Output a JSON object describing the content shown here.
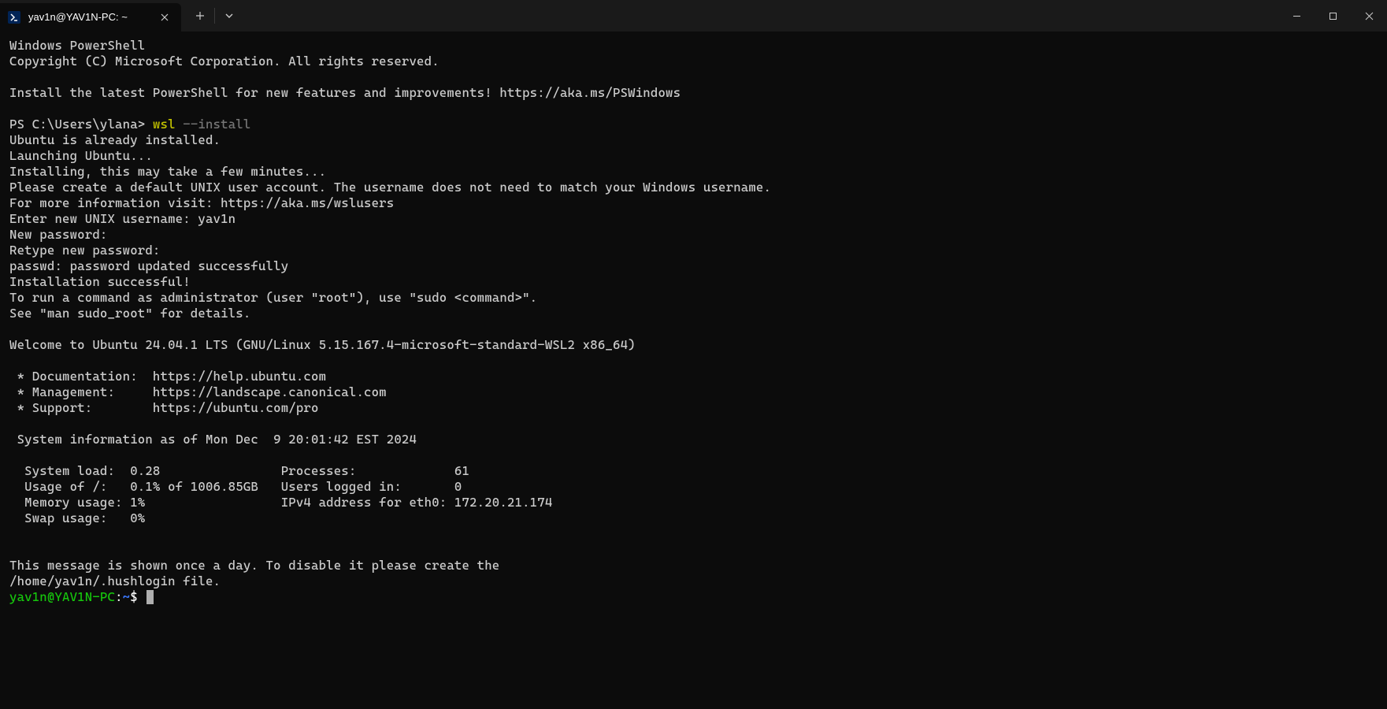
{
  "titlebar": {
    "tab_title": "yav1n@YAV1N-PC: ~"
  },
  "terminal": {
    "header1": "Windows PowerShell",
    "header2": "Copyright (C) Microsoft Corporation. All rights reserved.",
    "install_msg": "Install the latest PowerShell for new features and improvements! https://aka.ms/PSWindows",
    "prompt_prefix": "PS C:\\Users\\ylana> ",
    "cmd_part1": "wsl",
    "cmd_part2": " --install",
    "lines": [
      "Ubuntu is already installed.",
      "Launching Ubuntu...",
      "Installing, this may take a few minutes...",
      "Please create a default UNIX user account. The username does not need to match your Windows username.",
      "For more information visit: https://aka.ms/wslusers",
      "Enter new UNIX username: yav1n",
      "New password:",
      "Retype new password:",
      "passwd: password updated successfully",
      "Installation successful!",
      "To run a command as administrator (user \"root\"), use \"sudo <command>\".",
      "See \"man sudo_root\" for details.",
      "",
      "Welcome to Ubuntu 24.04.1 LTS (GNU/Linux 5.15.167.4-microsoft-standard-WSL2 x86_64)",
      "",
      " * Documentation:  https://help.ubuntu.com",
      " * Management:     https://landscape.canonical.com",
      " * Support:        https://ubuntu.com/pro",
      "",
      " System information as of Mon Dec  9 20:01:42 EST 2024",
      "",
      "  System load:  0.28                Processes:             61",
      "  Usage of /:   0.1% of 1006.85GB   Users logged in:       0",
      "  Memory usage: 1%                  IPv4 address for eth0: 172.20.21.174",
      "  Swap usage:   0%",
      "",
      "",
      "This message is shown once a day. To disable it please create the",
      "/home/yav1n/.hushlogin file."
    ],
    "bash_prompt_user": "yav1n@YAV1N-PC",
    "bash_prompt_colon": ":",
    "bash_prompt_path": "~",
    "bash_prompt_dollar": "$ "
  }
}
